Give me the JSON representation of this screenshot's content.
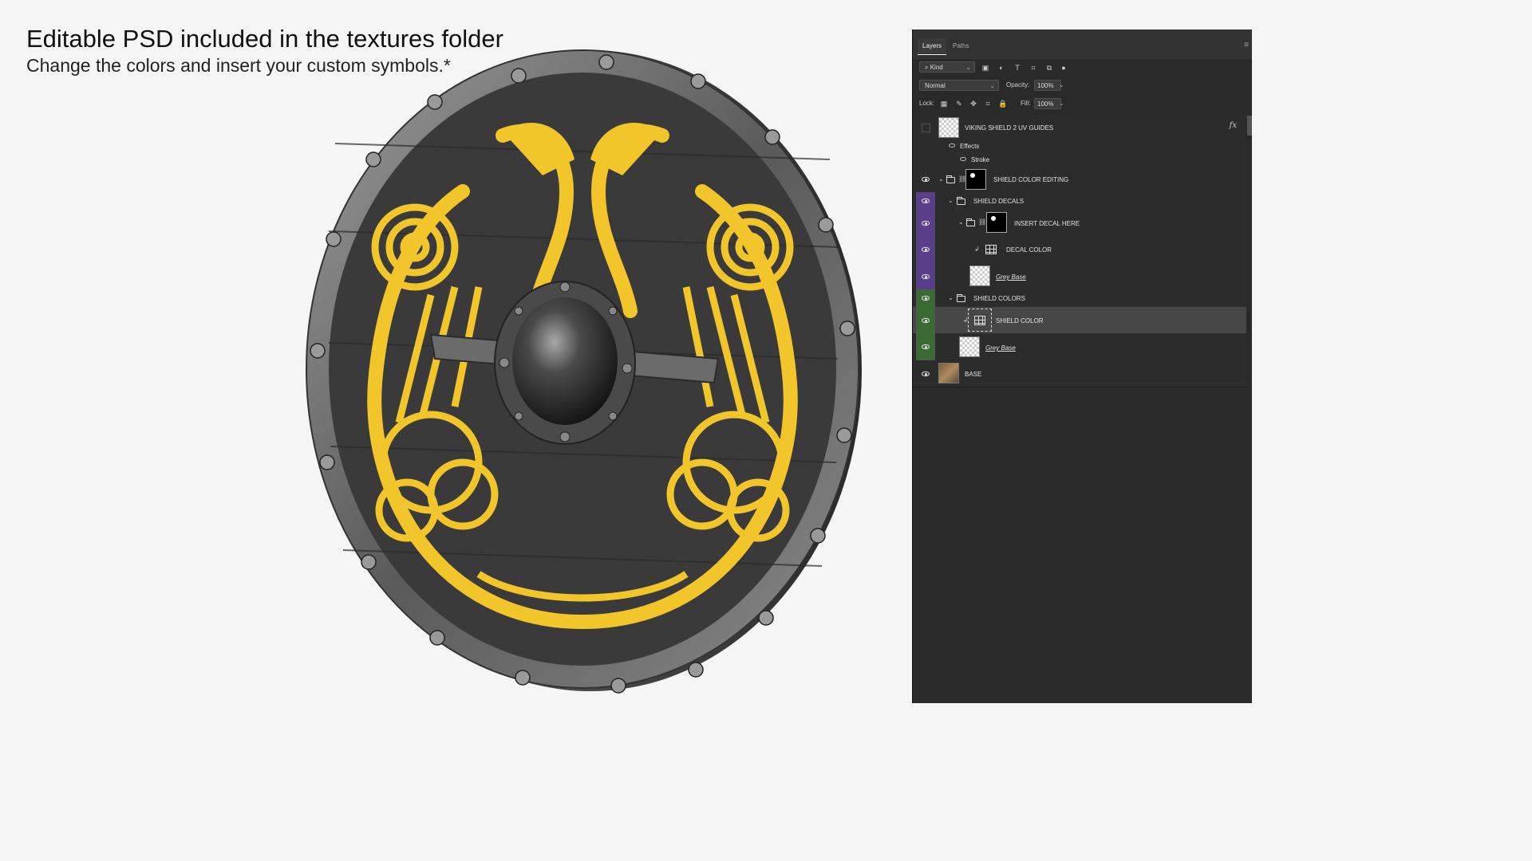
{
  "headline": {
    "title": "Editable PSD included in the textures folder",
    "subtitle": "Change the colors and insert your custom symbols.*"
  },
  "panel": {
    "tabs": [
      "Layers",
      "Paths"
    ],
    "filter": {
      "kind_label": "Kind"
    },
    "blend_mode": "Normal",
    "opacity_label": "Opacity:",
    "opacity_value": "100%",
    "lock_label": "Lock:",
    "fill_label": "Fill:",
    "fill_value": "100%",
    "layers": [
      {
        "name": "VIKING SHIELD 2 UV GUIDES",
        "fx": "fx"
      },
      {
        "name": "Effects"
      },
      {
        "name": "Stroke"
      },
      {
        "name": "SHIELD COLOR EDITING"
      },
      {
        "name": "SHIELD DECALS"
      },
      {
        "name": "INSERT DECAL HERE"
      },
      {
        "name": "DECAL COLOR"
      },
      {
        "name": "Grey Base"
      },
      {
        "name": "SHIELD COLORS"
      },
      {
        "name": "SHIELD COLOR"
      },
      {
        "name": "Grey Base"
      },
      {
        "name": "BASE"
      }
    ],
    "colors": {
      "purple_tag": "#5a3e8a",
      "green_tag": "#3b6a35"
    }
  },
  "shield": {
    "colors": {
      "wood": "#3a3a3a",
      "paint": "#f2c52a",
      "rim": "#6e6e6e"
    }
  }
}
